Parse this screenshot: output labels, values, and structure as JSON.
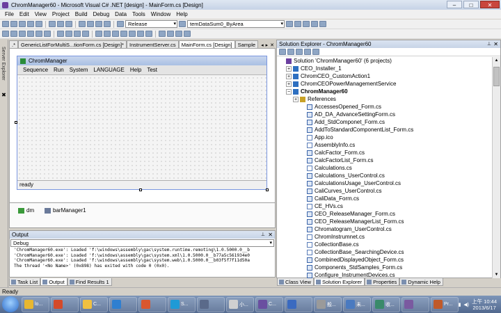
{
  "window": {
    "title": "ChromManager60 - Microsoft Visual C# .NET [design] - MainForm.cs [Design]",
    "min_label": "–",
    "max_label": "□",
    "close_label": "✕"
  },
  "menu": [
    "File",
    "Edit",
    "View",
    "Project",
    "Build",
    "Debug",
    "Data",
    "Tools",
    "Window",
    "Help"
  ],
  "toolbar": {
    "config": "Release",
    "find_combo": "temDataSum0_ByArea"
  },
  "left_strip": {
    "server_explorer": "Server Explorer",
    "toolbox_icon": "✖"
  },
  "doc_tabs": {
    "tabs": [
      ".* ",
      "GenericListForMultiS...tionForm.cs [Design]*",
      "InstrumentServer.cs",
      "MainForm.cs [Design]",
      "Sample"
    ],
    "controls": [
      "◂",
      "▸",
      "✕"
    ]
  },
  "designer": {
    "form_title": "ChromManager",
    "form_menu": [
      "Sequence",
      "Run",
      "System",
      "LANGUAGE",
      "Help",
      "Test"
    ],
    "status_text": "ready",
    "components": [
      "dm",
      "barManager1"
    ]
  },
  "output": {
    "title": "Output",
    "pin": "⊥",
    "close": "✕",
    "source": "Debug",
    "lines": [
      "'ChromManager60.exe': Loaded 'f:\\windows\\assembly\\gac\\system.runtime.remoting\\1.0.5000.0__b",
      "'ChromManager60.exe': Loaded 'f:\\windows\\assembly\\gac\\system.xml\\1.0.5000.0__b77a5c561934e0",
      "'ChromManager60.exe': Loaded 'f:\\windows\\assembly\\gac\\system.web\\1.0.5000.0__b03f5f7f11d50a",
      "The thread '<No Name>' (0x898) has exited with code 0 (0x0)."
    ]
  },
  "bottom_tabs_left": [
    "Task List",
    "Output",
    "Find Results 1"
  ],
  "bottom_tabs_right": [
    "Class View",
    "Solution Explorer",
    "Properties",
    "Dynamic Help"
  ],
  "solution_explorer": {
    "title": "Solution Explorer - ChromManager60",
    "pin": "⊥",
    "close": "✕",
    "tree": [
      {
        "label": "Solution 'ChromManager60' (6 projects)",
        "indent": 0,
        "type": "sol",
        "exp": ""
      },
      {
        "label": "CEO_Installer_1",
        "indent": 1,
        "type": "proj",
        "exp": "+"
      },
      {
        "label": "ChromCEO_CustomAction1",
        "indent": 1,
        "type": "proj",
        "exp": "+"
      },
      {
        "label": "ChromCEOPowerManagementService",
        "indent": 1,
        "type": "proj",
        "exp": "+"
      },
      {
        "label": "ChromManager60",
        "indent": 1,
        "type": "proj",
        "exp": "−",
        "bold": true
      },
      {
        "label": "References",
        "indent": 2,
        "type": "ref",
        "exp": "+"
      },
      {
        "label": "AccessesOpened_Form.cs",
        "indent": 3,
        "type": "form",
        "exp": ""
      },
      {
        "label": "AD_DA_AdvanceSettingForm.cs",
        "indent": 3,
        "type": "form",
        "exp": ""
      },
      {
        "label": "Add_StdComponet_Form.cs",
        "indent": 3,
        "type": "form",
        "exp": ""
      },
      {
        "label": "AddToStandardComponentList_Form.cs",
        "indent": 3,
        "type": "form",
        "exp": ""
      },
      {
        "label": "App.ico",
        "indent": 3,
        "type": "file",
        "exp": ""
      },
      {
        "label": "AssemblyInfo.cs",
        "indent": 3,
        "type": "file",
        "exp": ""
      },
      {
        "label": "CalcFactor_Form.cs",
        "indent": 3,
        "type": "form",
        "exp": ""
      },
      {
        "label": "CalcFactorList_Form.cs",
        "indent": 3,
        "type": "form",
        "exp": ""
      },
      {
        "label": "Calculations.cs",
        "indent": 3,
        "type": "file",
        "exp": ""
      },
      {
        "label": "Calculations_UserControl.cs",
        "indent": 3,
        "type": "form",
        "exp": ""
      },
      {
        "label": "CalculationsUsage_UserControl.cs",
        "indent": 3,
        "type": "form",
        "exp": ""
      },
      {
        "label": "CaliCurves_UserControl.cs",
        "indent": 3,
        "type": "form",
        "exp": ""
      },
      {
        "label": "CaliData_Form.cs",
        "indent": 3,
        "type": "form",
        "exp": ""
      },
      {
        "label": "CE_HVs.cs",
        "indent": 3,
        "type": "file",
        "exp": ""
      },
      {
        "label": "CEO_ReleaseManager_Form.cs",
        "indent": 3,
        "type": "form",
        "exp": ""
      },
      {
        "label": "CEO_ReleaseManagerList_Form.cs",
        "indent": 3,
        "type": "form",
        "exp": ""
      },
      {
        "label": "Chromatogram_UserControl.cs",
        "indent": 3,
        "type": "form",
        "exp": ""
      },
      {
        "label": "ChromInstrumnet.cs",
        "indent": 3,
        "type": "file",
        "exp": ""
      },
      {
        "label": "CollectionBase.cs",
        "indent": 3,
        "type": "file",
        "exp": ""
      },
      {
        "label": "CollectionBase_SearchingDevice.cs",
        "indent": 3,
        "type": "file",
        "exp": ""
      },
      {
        "label": "CombinedDisplayedObject_Form.cs",
        "indent": 3,
        "type": "form",
        "exp": ""
      },
      {
        "label": "Components_StdSamples_Form.cs",
        "indent": 3,
        "type": "form",
        "exp": ""
      },
      {
        "label": "Configure_InstrumentDevices.cs",
        "indent": 3,
        "type": "form",
        "exp": ""
      }
    ]
  },
  "status_bar": "Ready",
  "taskbar": {
    "tasks": [
      "lo...",
      "",
      "C...",
      "",
      "",
      "S...",
      "",
      "小...",
      "C...",
      "",
      "般...",
      "未...",
      "收...",
      "",
      "Pr..."
    ],
    "time": "上午 10:44",
    "date": "2013/6/17"
  }
}
